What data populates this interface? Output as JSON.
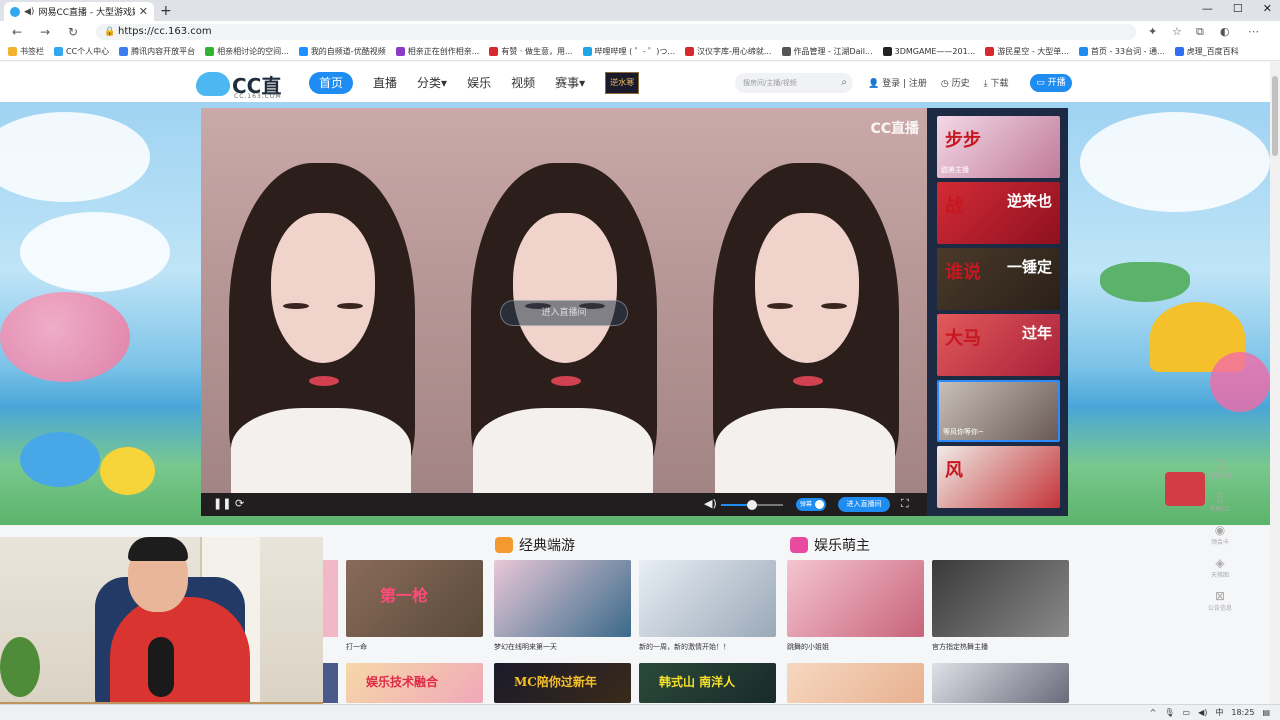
{
  "browser": {
    "tab_title": "网易CC直播 - 大型游戏娱乐",
    "tab_close": "✕",
    "new_tab": "+",
    "url": "https://cc.163.com",
    "window_buttons": [
      "—",
      "☐",
      "✕"
    ],
    "bookmarks": [
      {
        "label": "书签栏",
        "color": "#f2b22e"
      },
      {
        "label": "CC个人中心",
        "color": "#2fa8ef"
      },
      {
        "label": "腾讯内容开放平台",
        "color": "#3d7bf0"
      },
      {
        "label": "相亲相讨论的空间...",
        "color": "#33b233"
      },
      {
        "label": "我的自频道-优酷视频",
        "color": "#1e90ff"
      },
      {
        "label": "相亲正在创作相亲...",
        "color": "#8a3cc8"
      },
      {
        "label": "有赞 · 做生意，用...",
        "color": "#d6292d"
      },
      {
        "label": "哔哩哔哩 ( ゜- ゜)つ...",
        "color": "#1ea5e6"
      },
      {
        "label": "汉仪字库-用心缔就...",
        "color": "#d6292d"
      },
      {
        "label": "作品管理 - 江湖Dail...",
        "color": "#555555"
      },
      {
        "label": "3DMGAME——201...",
        "color": "#222222"
      },
      {
        "label": "游民星空 - 大型单...",
        "color": "#d6292d"
      },
      {
        "label": "首页 - 33台词 - 通...",
        "color": "#1e8cf0"
      },
      {
        "label": "虎理_百度百科",
        "color": "#2f6ef0"
      }
    ]
  },
  "header": {
    "logo_text": "CC直播",
    "logo_sub": "CC.163.COM",
    "nav": [
      {
        "label": "首页",
        "active": true
      },
      {
        "label": "直播",
        "active": false
      },
      {
        "label": "分类",
        "active": false,
        "caret": "▾"
      },
      {
        "label": "娱乐",
        "active": false
      },
      {
        "label": "视频",
        "active": false
      },
      {
        "label": "赛事",
        "active": false,
        "caret": "▾"
      }
    ],
    "game_badge": "逆水寒",
    "search_placeholder": "搜房间/主播/视频",
    "login": "登录",
    "register": "注册",
    "history": "历史",
    "download": "下载",
    "live_button": "开播"
  },
  "player": {
    "watermark": "CC直播",
    "enter_overlay": "进入直播间",
    "danmu_label": "弹幕",
    "enter_room": "进入直播间",
    "volume": 0.5
  },
  "side_thumbs": [
    {
      "big": "步步",
      "label": "甜美主播",
      "bg": "linear-gradient(135deg,#f3d8e6,#c07a9a)",
      "selected": false
    },
    {
      "big": "战",
      "big2": "逆来也",
      "label": "",
      "bg": "linear-gradient(135deg,#d42b36,#8e1020)",
      "selected": false
    },
    {
      "big": "谁说",
      "big2": "一锤定",
      "label": "",
      "bg": "linear-gradient(135deg,#4a3a2a,#2a2018)",
      "selected": false
    },
    {
      "big": "大马",
      "big2": "过年",
      "label": "",
      "bg": "linear-gradient(135deg,#e25a5a,#a8203a)",
      "selected": false
    },
    {
      "big": "",
      "label": "等风你等你~",
      "bg": "linear-gradient(135deg,#c8c0b8,#6a5a56)",
      "selected": true
    },
    {
      "big": "风",
      "label": "",
      "bg": "linear-gradient(135deg,#f0ece8,#c43438)",
      "selected": false
    }
  ],
  "sections": [
    {
      "title": "经典端游",
      "color": "#f29a2e"
    },
    {
      "title": "娱乐萌主",
      "color": "#e84aa0"
    }
  ],
  "cards_row1": [
    {
      "caption": "打一命",
      "bg": "linear-gradient(135deg,#8a6b5a,#5a4a3a)",
      "title": "第一枪",
      "tcolor": "#ff4a7a"
    },
    {
      "caption": "梦幻在线明来第一天",
      "bg": "linear-gradient(135deg,#e8c8d8,#3a6a8a)",
      "title": "",
      "tcolor": "#fff"
    },
    {
      "caption": "新的一周，新的激情开始！！",
      "bg": "linear-gradient(135deg,#e8eef4,#9aa8b8)",
      "title": "",
      "tcolor": "#fff"
    },
    {
      "caption": "跳舞的小姐姐",
      "bg": "linear-gradient(135deg,#f4c4d0,#c8647a)",
      "title": "",
      "tcolor": "#fff"
    },
    {
      "caption": "官方指定热舞主播",
      "bg": "linear-gradient(135deg,#3a3a3a,#8a8a8a)",
      "title": "",
      "tcolor": "#fff"
    }
  ],
  "cards_row2": [
    {
      "caption": "",
      "bg": "linear-gradient(135deg,#f6d8a8,#f0a8b8)",
      "title": "娱乐技术融合",
      "tcolor": "#e02a48"
    },
    {
      "caption": "",
      "bg": "linear-gradient(135deg,#1a1a2a,#3a2a1a)",
      "title": "MC陪你过新年",
      "tcolor": "#f6c02a"
    },
    {
      "caption": "",
      "bg": "linear-gradient(135deg,#2a4a3a,#1a2a2a)",
      "title": "韩式山 南洋人",
      "tcolor": "#f6e02a"
    },
    {
      "caption": "",
      "bg": "linear-gradient(135deg,#f6d8c0,#e8b090)",
      "title": "",
      "tcolor": "#fff"
    },
    {
      "caption": "",
      "bg": "linear-gradient(135deg,#e0e0e8,#6a6a7a)",
      "title": "",
      "tcolor": "#fff"
    }
  ],
  "tools": [
    {
      "icon": "□",
      "label": "我要开播"
    },
    {
      "icon": "▯",
      "label": "手机CC"
    },
    {
      "icon": "◉",
      "label": "领会卡"
    },
    {
      "icon": "◈",
      "label": "天梯图"
    },
    {
      "icon": "⊠",
      "label": "公告信息"
    }
  ],
  "taskbar": {
    "time": "18:25"
  }
}
